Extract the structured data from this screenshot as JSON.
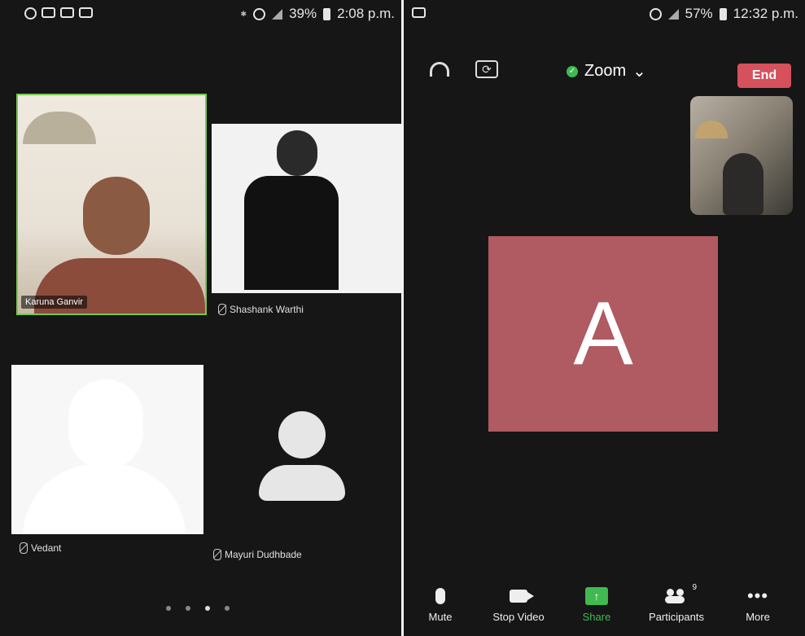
{
  "left_phone": {
    "status": {
      "battery": "39%",
      "time": "2:08 p.m."
    },
    "participants": [
      {
        "name": "Karuna Ganvir"
      },
      {
        "name": "Shashank Warthi"
      },
      {
        "name": "Vedant"
      },
      {
        "name": "Mayuri Dudhbade"
      }
    ]
  },
  "right_phone": {
    "status": {
      "battery": "57%",
      "time": "12:32 p.m."
    },
    "meeting": {
      "title": "Zoom",
      "end_label": "End",
      "avatar_letter": "A"
    },
    "toolbar": {
      "mute": "Mute",
      "stop_video": "Stop Video",
      "share": "Share",
      "participants": "Participants",
      "participants_count": "9",
      "more": "More"
    }
  },
  "colors": {
    "end": "#d5515c",
    "share": "#3fb950",
    "speaker_border": "#7ac74f",
    "avatar_bg": "#b05a61"
  },
  "icons": [
    "whatsapp-icon",
    "mail-icon",
    "video-icon",
    "headphone-icon",
    "camera-flip-icon",
    "shield-icon",
    "mic-icon",
    "video-camera-icon",
    "share-icon",
    "people-icon",
    "more-icon"
  ]
}
